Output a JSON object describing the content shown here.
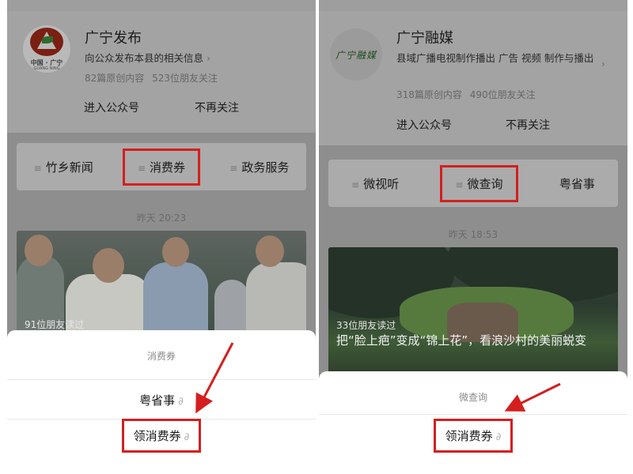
{
  "panels": {
    "left": {
      "account": {
        "name": "广宁发布",
        "description": "向公众发布本县的相关信息",
        "stats": "82篇原创内容 523位朋友关注",
        "logo_caption": "中国 · 广宁",
        "logo_subcaption": "GUANG NING"
      },
      "actions": [
        "进入公众号",
        "不再关注"
      ],
      "menu": [
        "竹乡新闻",
        "消费券",
        "政务服务"
      ],
      "timestamp": "昨天 20:23",
      "article": {
        "readers": "91位朋友读过"
      },
      "sheet": {
        "title": "消费券",
        "items": [
          "粤省事",
          "领消费券"
        ]
      }
    },
    "right": {
      "account": {
        "name": "广宁融媒",
        "description": "县域广播电视制作播出 广告 视频 制作与播出",
        "stats": "318篇原创内容 490位朋友关注",
        "logo_text": "广宁融媒"
      },
      "actions": [
        "进入公众号",
        "不再关注"
      ],
      "menu": [
        "微视听",
        "微查询",
        "粤省事"
      ],
      "timestamp": "昨天 18:53",
      "article": {
        "readers": "33位朋友读过",
        "headline": "把“脸上疤”变成“锦上花”，看浪沙村的美丽蜕变"
      },
      "sheet": {
        "title": "微查询",
        "items": [
          "领消费券"
        ]
      }
    }
  },
  "colors": {
    "highlight_box": "#d41f1f",
    "overlay": "#8e8e8e"
  },
  "icons": {
    "menu_marker": "menu-lines-icon",
    "miniprogram": "link-icon",
    "chevron": "chevron-right-icon"
  }
}
